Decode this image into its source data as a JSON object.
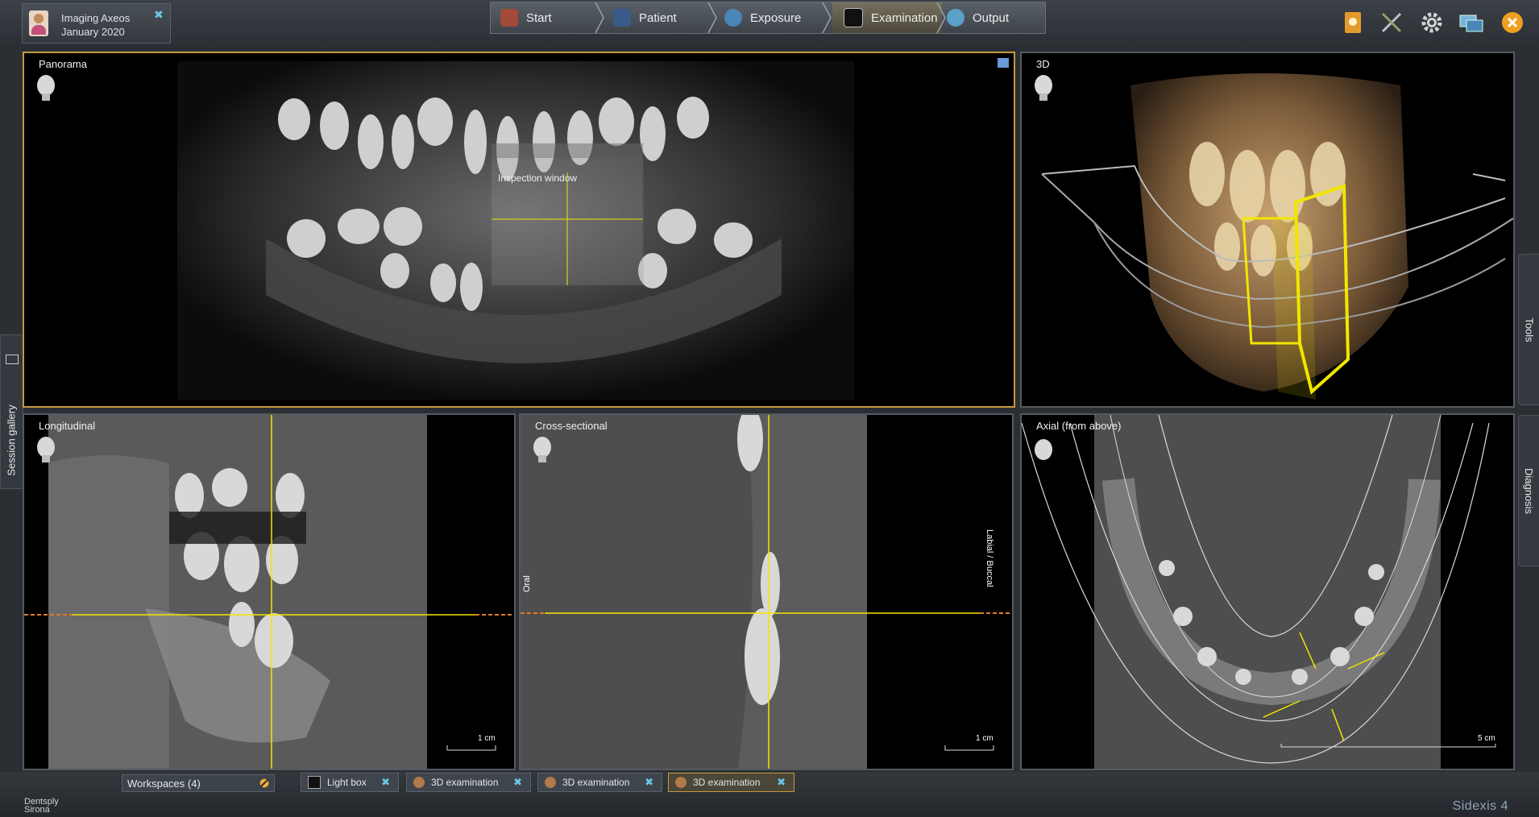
{
  "patient": {
    "name": "Imaging Axeos",
    "date": "January 2020"
  },
  "workflow": [
    "Start",
    "Patient",
    "Exposure",
    "Examination",
    "Output"
  ],
  "workflow_active": "Examination",
  "top_icons": [
    "notebook-icon",
    "tools-icon",
    "gear-icon",
    "monitor-icon",
    "close-icon"
  ],
  "views": {
    "panorama": {
      "label": "Panorama",
      "inspection": "Inspection window"
    },
    "three_d": {
      "label": "3D"
    },
    "longitudinal": {
      "label": "Longitudinal",
      "scale": "1 cm"
    },
    "cross": {
      "label": "Cross-sectional",
      "scale": "1 cm",
      "oral": "Oral",
      "labial": "Labial / Buccal"
    },
    "axial": {
      "label": "Axial (from above)",
      "scale": "5 cm"
    }
  },
  "side_tabs": {
    "gallery": "Session gallery",
    "tools": "Tools",
    "diagnosis": "Diagnosis"
  },
  "workspaces": "Workspaces (4)",
  "bottom_tabs": [
    "Light box",
    "3D examination",
    "3D examination",
    "3D examination"
  ],
  "brand": {
    "line1": "Dentsply",
    "line2": "Sirona"
  },
  "product": "Sidexis 4",
  "colors": {
    "active_border": "#c69a3a",
    "crosshair": "#f2e600",
    "scale_dash": "#e07a2a",
    "accent_x": "#6cc6e8"
  }
}
